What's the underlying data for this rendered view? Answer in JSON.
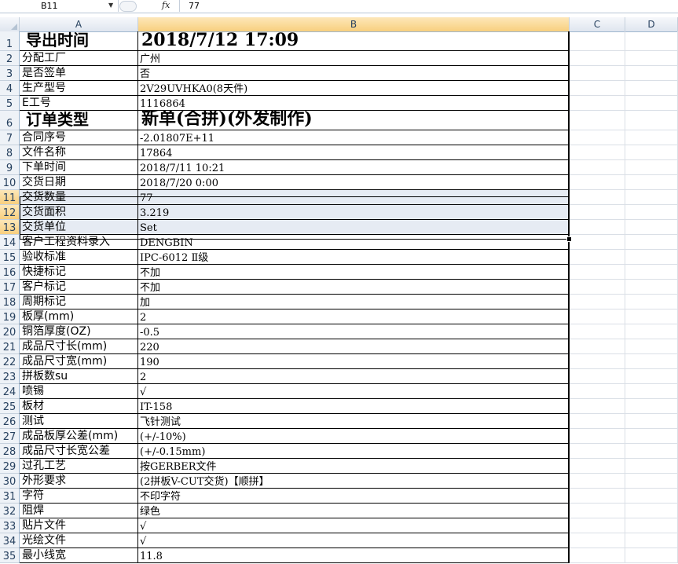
{
  "formula_bar": {
    "name_box": "B11",
    "fx_label": "fx",
    "value": "77"
  },
  "columns": [
    "A",
    "B",
    "C",
    "D"
  ],
  "rows": [
    {
      "num": "1",
      "a": "导出时间",
      "b": "2018/7/12  17:09",
      "big": true
    },
    {
      "num": "2",
      "a": "分配工厂",
      "b": "广州"
    },
    {
      "num": "3",
      "a": "是否签单",
      "b": "否"
    },
    {
      "num": "4",
      "a": "生产型号",
      "b": "2V29UVHKA0(8天件)"
    },
    {
      "num": "5",
      "a": "E工号",
      "b": "1116864"
    },
    {
      "num": "6",
      "a": "订单类型",
      "b": "新单(合拼)(外发制作)",
      "big": true
    },
    {
      "num": "7",
      "a": "合同序号",
      "b": "-2.01807E+11"
    },
    {
      "num": "8",
      "a": "文件名称",
      "b": "17864"
    },
    {
      "num": "9",
      "a": "下单时间",
      "b": "2018/7/11 10:21"
    },
    {
      "num": "10",
      "a": "交货日期",
      "b": "2018/7/20 0:00"
    },
    {
      "num": "11",
      "a": "交货数量",
      "b": "77",
      "sel": true
    },
    {
      "num": "12",
      "a": "交货面积",
      "b": "3.219",
      "sel": true
    },
    {
      "num": "13",
      "a": "交货单位",
      "b": "Set",
      "sel": true
    },
    {
      "num": "14",
      "a": "客户工程资料录入",
      "b": "DENGBIN"
    },
    {
      "num": "15",
      "a": "验收标准",
      "b": "IPC-6012 Ⅱ级"
    },
    {
      "num": "16",
      "a": "快捷标记",
      "b": "不加"
    },
    {
      "num": "17",
      "a": "客户标记",
      "b": "不加"
    },
    {
      "num": "18",
      "a": "周期标记",
      "b": "加"
    },
    {
      "num": "19",
      "a": "板厚(mm)",
      "b": "2"
    },
    {
      "num": "20",
      "a": "铜箔厚度(OZ)",
      "b": "-0.5"
    },
    {
      "num": "21",
      "a": "成品尺寸长(mm)",
      "b": "220"
    },
    {
      "num": "22",
      "a": "成品尺寸宽(mm)",
      "b": "190"
    },
    {
      "num": "23",
      "a": "拼板数su",
      "b": "2"
    },
    {
      "num": "24",
      "a": "喷锡",
      "b": "√"
    },
    {
      "num": "25",
      "a": "板材",
      "b": "IT-158"
    },
    {
      "num": "26",
      "a": "测试",
      "b": "飞针测试"
    },
    {
      "num": "27",
      "a": "成品板厚公差(mm)",
      "b": "(+/-10%)"
    },
    {
      "num": "28",
      "a": "成品尺寸长宽公差",
      "b": "(+/-0.15mm)"
    },
    {
      "num": "29",
      "a": "过孔工艺",
      "b": "按GERBER文件"
    },
    {
      "num": "30",
      "a": "外形要求",
      "b": "(2拼板V-CUT交货)【顺拼】"
    },
    {
      "num": "31",
      "a": "字符",
      "b": "不印字符"
    },
    {
      "num": "32",
      "a": "阻焊",
      "b": "绿色"
    },
    {
      "num": "33",
      "a": "贴片文件",
      "b": "√"
    },
    {
      "num": "34",
      "a": "光绘文件",
      "b": "√"
    },
    {
      "num": "35",
      "a": "最小线宽",
      "b": "11.8"
    }
  ]
}
